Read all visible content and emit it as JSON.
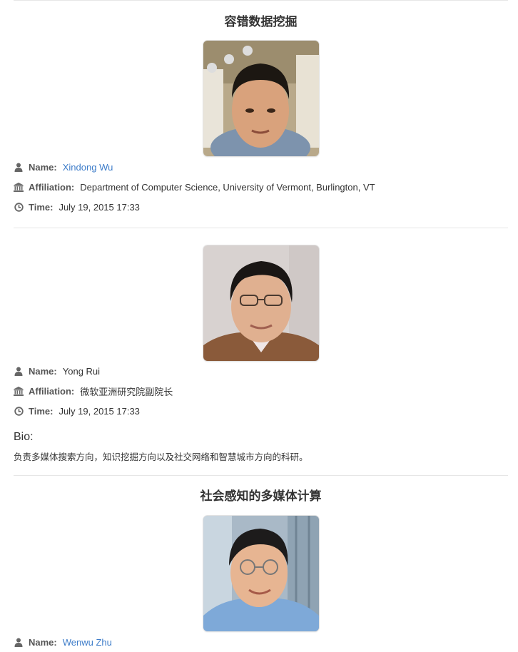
{
  "labels": {
    "name": "Name:",
    "affiliation": "Affiliation:",
    "time": "Time:",
    "bio": "Bio:"
  },
  "talks": [
    {
      "title": "容错数据挖掘",
      "photo_alt": "Xindong Wu portrait",
      "name": "Xindong Wu",
      "affiliation": "Department of Computer Science, University of Vermont, Burlington, VT",
      "time": "July 19, 2015  17:33"
    },
    {
      "title": "",
      "photo_alt": "Yong Rui portrait",
      "name": "Yong Rui",
      "affiliation": "微软亚洲研究院副院长",
      "time": "July 19, 2015  17:33",
      "bio": "负责多媒体搜索方向，知识挖掘方向以及社交网络和智慧城市方向的科研。"
    },
    {
      "title": "社会感知的多媒体计算",
      "photo_alt": "Wenwu Zhu portrait",
      "name": "Wenwu Zhu"
    }
  ],
  "colors": {
    "link": "#3d7cc9",
    "divider": "#e6e6e6",
    "label": "#555555",
    "icon": "#666666"
  },
  "icons": {
    "name": "user-icon",
    "affiliation": "institution-icon",
    "time": "clock-icon"
  }
}
